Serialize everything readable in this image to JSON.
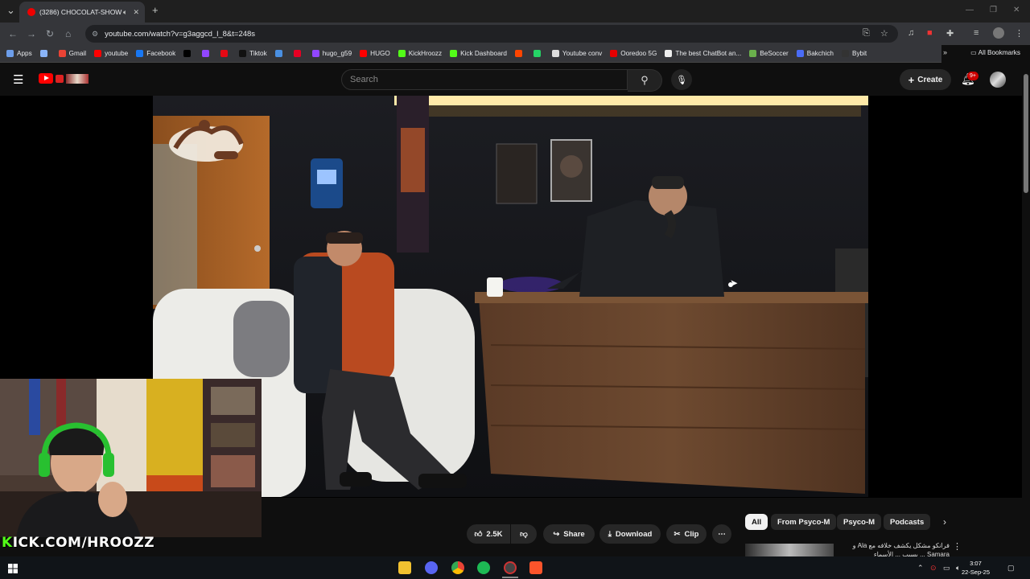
{
  "browser": {
    "tab_title": "(3286) CHOCOLAT-SHOW",
    "url": "youtube.com/watch?v=g3aggcd_l_8&t=248s",
    "bookmarks": [
      {
        "label": "Apps",
        "color": "#6d9eeb"
      },
      {
        "label": "",
        "color": "#8ab4f8"
      },
      {
        "label": "Gmail",
        "color": "#ea4335"
      },
      {
        "label": "youtube",
        "color": "#ff0000"
      },
      {
        "label": "Facebook",
        "color": "#1877f2"
      },
      {
        "label": "",
        "color": "#000000"
      },
      {
        "label": "",
        "color": "#9146ff"
      },
      {
        "label": "",
        "color": "#e50914"
      },
      {
        "label": "Tiktok",
        "color": "#111111"
      },
      {
        "label": "",
        "color": "#4a90e2"
      },
      {
        "label": "",
        "color": "#e60023"
      },
      {
        "label": "hugo_g59",
        "color": "#9146ff"
      },
      {
        "label": "HUGO",
        "color": "#ff0000"
      },
      {
        "label": "KickHroozz",
        "color": "#53fc18"
      },
      {
        "label": "Kick Dashboard",
        "color": "#53fc18"
      },
      {
        "label": "",
        "color": "#ff4500"
      },
      {
        "label": "",
        "color": "#25d366"
      },
      {
        "label": "Youtube conv",
        "color": "#dddddd"
      },
      {
        "label": "Ooredoo 5G",
        "color": "#e60000"
      },
      {
        "label": "The best ChatBot an...",
        "color": "#eeeeee"
      },
      {
        "label": "BeSoccer",
        "color": "#6ab04c"
      },
      {
        "label": "Bakchich",
        "color": "#4a6cf7"
      },
      {
        "label": "Bybit",
        "color": "#333333"
      }
    ],
    "all_bookmarks": "All Bookmarks"
  },
  "youtube": {
    "search_placeholder": "Search",
    "create_label": "Create",
    "notification_count": "9+"
  },
  "video": {
    "overlay_text": "KICK.COM/HROOZZ"
  },
  "actions": {
    "likes": "2.5K",
    "share": "Share",
    "download": "Download",
    "clip": "Clip"
  },
  "chips": [
    "All",
    "From Psyco-M",
    "Psyco-M",
    "Podcasts"
  ],
  "recommendation": {
    "title_line1": "فرانكو مشكل يكشف خلافه مع Ala و",
    "title_line2": "Samara ... بسبب ... الأسماء"
  },
  "taskbar": {
    "time": "3:07",
    "date": "22-Sep-25"
  },
  "colors": {
    "accent_red": "#ff0000",
    "kick_green": "#53fc18"
  }
}
